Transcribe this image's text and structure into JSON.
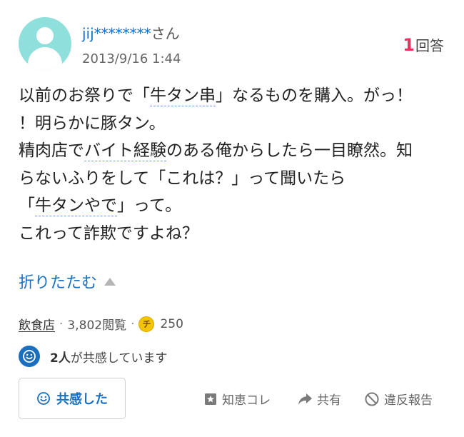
{
  "question": {
    "user": {
      "name": "jij********",
      "honorific": "さん"
    },
    "date": "2013/9/16 1:44",
    "answers": {
      "count": "1",
      "label": "回答"
    },
    "body": {
      "line1_a": "以前のお祭りで「",
      "line1_kw": "牛タン串",
      "line1_b": "」なるものを購入。がっ！",
      "line2": "！明らかに豚タン。",
      "line3_a": "精肉店で",
      "line3_kw": "バイト経験",
      "line3_b": "のある俺からしたら一目瞭然。知",
      "line4": "らないふりをして「これは？」って聞いたら",
      "line5_a": "「",
      "line5_kw": "牛タンやで",
      "line5_b": "」って。",
      "line6": "これって詐欺ですよね？"
    },
    "collapse_label": "折りたたむ",
    "meta": {
      "category": "飲食店",
      "views": "3,802閲覧",
      "coin_symbol": "チ",
      "coins": "250"
    },
    "empathy": {
      "count": "2人",
      "text": "が共感しています"
    },
    "actions": {
      "empathy_button": "共感した",
      "chiekore": "知恵コレ",
      "share": "共有",
      "report": "違反報告"
    }
  },
  "colors": {
    "link": "#1a6fbf",
    "accent": "#e0385c",
    "avatar": "#8fe0dc",
    "coin": "#f5c400"
  }
}
